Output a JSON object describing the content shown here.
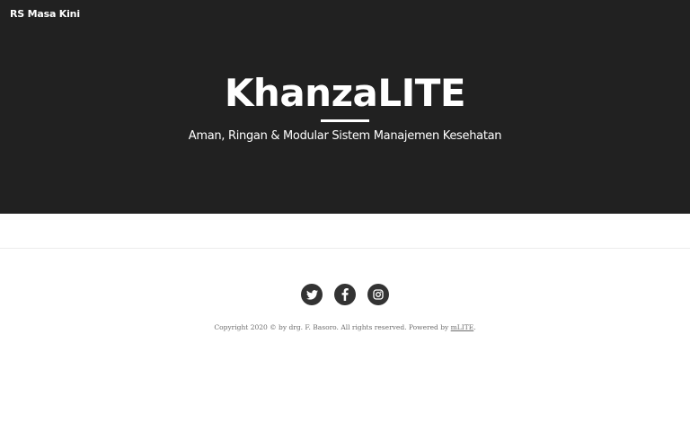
{
  "header": {
    "brand": "RS Masa Kini"
  },
  "hero": {
    "title": "KhanzaLITE",
    "subtitle": "Aman, Ringan & Modular Sistem Manajemen Kesehatan"
  },
  "footer": {
    "social": [
      {
        "icon": "twitter-icon"
      },
      {
        "icon": "facebook-icon"
      },
      {
        "icon": "instagram-icon"
      }
    ],
    "copyright_text": "Copyright 2020 © by drg. F. Basoro. All rights reserved. Powered by ",
    "powered_link": "mLITE",
    "copyright_end": "."
  },
  "colors": {
    "hero_bg": "#212121",
    "icon_bg": "#333333",
    "text_muted": "#6f6f6f"
  }
}
